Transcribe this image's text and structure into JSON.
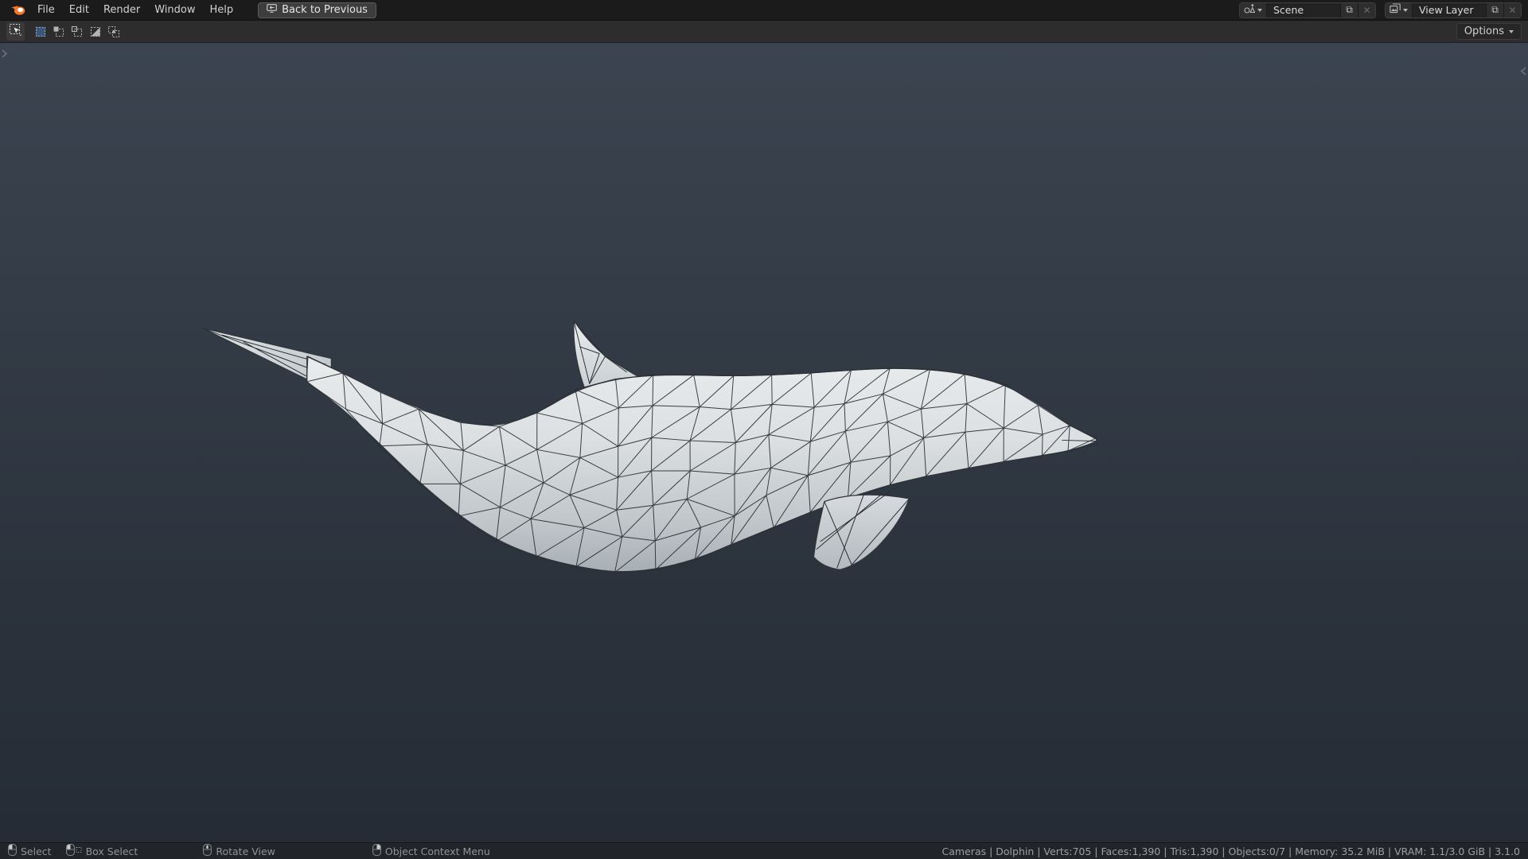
{
  "colors": {
    "topbar_bg": "#1b1b1b",
    "header_bg": "#2d2d2d",
    "statusbar_bg": "#212428",
    "viewport_top": "#3b4450",
    "viewport_mid": "#2b323c",
    "viewport_bottom": "#252c35",
    "accent_blue": "#4772b3",
    "logo_orange": "#f5792a",
    "text": "#d6d6d6",
    "dim_text": "#8f9499",
    "mesh_surface": "#dce0e2",
    "mesh_wire": "#2a2e33"
  },
  "topbar": {
    "menus": [
      "File",
      "Edit",
      "Render",
      "Window",
      "Help"
    ],
    "back_button": "Back to Previous",
    "scene": {
      "value": "Scene"
    },
    "view_layer": {
      "value": "View Layer"
    }
  },
  "tool_header": {
    "active_tool": "Select Box",
    "select_mode_icons": [
      "select-mode-set",
      "select-mode-extend",
      "select-mode-subtract",
      "select-mode-invert",
      "select-mode-intersect"
    ],
    "active_mode_index": 0,
    "options_label": "Options"
  },
  "viewport": {
    "object_name": "Dolphin"
  },
  "statusbar": {
    "hints": [
      {
        "icon": "mouse-left-icon",
        "label": "Select"
      },
      {
        "icon": "mouse-left-drag-icon",
        "label": "Box Select"
      },
      {
        "icon": "mouse-middle-icon",
        "label": "Rotate View"
      },
      {
        "icon": "mouse-right-icon",
        "label": "Object Context Menu"
      }
    ],
    "info": "Cameras | Dolphin | Verts:705 | Faces:1,390 | Tris:1,390 | Objects:0/7 | Memory: 35.2 MiB | VRAM: 1.1/3.0 GiB | 3.1.0",
    "info_segments": [
      "Cameras",
      "Dolphin",
      "Verts:705",
      "Faces:1,390",
      "Tris:1,390",
      "Objects:0/7",
      "Memory: 35.2 MiB",
      "VRAM: 1.1/3.0 GiB",
      "3.1.0"
    ]
  }
}
